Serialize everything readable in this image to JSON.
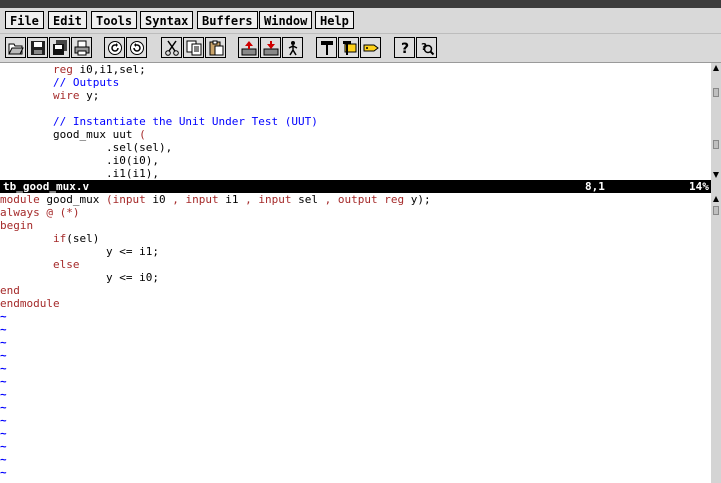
{
  "menu": {
    "file": "File",
    "edit": "Edit",
    "tools": "Tools",
    "syntax": "Syntax",
    "buffers": "Buffers",
    "window": "Window",
    "help": "Help"
  },
  "toolbar": {
    "icons": [
      "open-icon",
      "save-icon",
      "save-all-icon",
      "print-icon",
      "undo-icon",
      "redo-icon",
      "cut-icon",
      "copy-icon",
      "paste-icon",
      "load-session-icon",
      "save-session-icon",
      "run-script-icon",
      "make-icon",
      "build-tags-icon",
      "jump-to-tag-icon",
      "help-icon",
      "find-help-icon"
    ]
  },
  "top_pane": {
    "lines": [
      [
        {
          "t": "        "
        },
        {
          "t": "reg",
          "c": "kw"
        },
        {
          "t": " i0,i1,sel;"
        }
      ],
      [
        {
          "t": "        "
        },
        {
          "t": "// Outputs",
          "c": "comment"
        }
      ],
      [
        {
          "t": "        "
        },
        {
          "t": "wire",
          "c": "kw"
        },
        {
          "t": " y;"
        }
      ],
      [
        {
          "t": ""
        }
      ],
      [
        {
          "t": "        "
        },
        {
          "t": "// Instantiate the Unit Under Test (UUT)",
          "c": "comment"
        }
      ],
      [
        {
          "t": "        good_mux uut "
        },
        {
          "t": "(",
          "c": "kw"
        }
      ],
      [
        {
          "t": "                .sel(sel),"
        }
      ],
      [
        {
          "t": "                .i0(i0),"
        }
      ],
      [
        {
          "t": "                .i1(i1),"
        }
      ]
    ]
  },
  "status": {
    "filename": "tb_good_mux.v",
    "position": "8,1",
    "percent": "14%"
  },
  "bottom_pane": {
    "lines": [
      [
        {
          "t": "module",
          "c": "kw"
        },
        {
          "t": " good_mux "
        },
        {
          "t": "(",
          "c": "kw"
        },
        {
          "t": "input",
          "c": "kw"
        },
        {
          "t": " i0 "
        },
        {
          "t": ",",
          "c": "kw"
        },
        {
          "t": " "
        },
        {
          "t": "input",
          "c": "kw"
        },
        {
          "t": " i1 "
        },
        {
          "t": ",",
          "c": "kw"
        },
        {
          "t": " "
        },
        {
          "t": "input",
          "c": "kw"
        },
        {
          "t": " sel "
        },
        {
          "t": ",",
          "c": "kw"
        },
        {
          "t": " "
        },
        {
          "t": "output",
          "c": "kw"
        },
        {
          "t": " "
        },
        {
          "t": "reg",
          "c": "kw"
        },
        {
          "t": " y);"
        }
      ],
      [
        {
          "t": "always",
          "c": "kw"
        },
        {
          "t": " "
        },
        {
          "t": "@ (*)",
          "c": "kw"
        }
      ],
      [
        {
          "t": "begin",
          "c": "kw"
        }
      ],
      [
        {
          "t": "        "
        },
        {
          "t": "if",
          "c": "kw"
        },
        {
          "t": "(sel)"
        }
      ],
      [
        {
          "t": "                y <= i1;"
        }
      ],
      [
        {
          "t": "        "
        },
        {
          "t": "else",
          "c": "kw"
        }
      ],
      [
        {
          "t": "                y <= i0;"
        }
      ],
      [
        {
          "t": "end",
          "c": "kw"
        }
      ],
      [
        {
          "t": "endmodule",
          "c": "kw"
        }
      ],
      [
        {
          "t": "~",
          "c": "tilde"
        }
      ],
      [
        {
          "t": "~",
          "c": "tilde"
        }
      ],
      [
        {
          "t": "~",
          "c": "tilde"
        }
      ],
      [
        {
          "t": "~",
          "c": "tilde"
        }
      ],
      [
        {
          "t": "~",
          "c": "tilde"
        }
      ],
      [
        {
          "t": "~",
          "c": "tilde"
        }
      ],
      [
        {
          "t": "~",
          "c": "tilde"
        }
      ],
      [
        {
          "t": "~",
          "c": "tilde"
        }
      ],
      [
        {
          "t": "~",
          "c": "tilde"
        }
      ],
      [
        {
          "t": "~",
          "c": "tilde"
        }
      ],
      [
        {
          "t": "~",
          "c": "tilde"
        }
      ],
      [
        {
          "t": "~",
          "c": "tilde"
        }
      ],
      [
        {
          "t": "~",
          "c": "tilde"
        }
      ]
    ]
  },
  "colors": {
    "kw": "#a52a2a",
    "comment": "#0000ff",
    "tilde": "#0000ff",
    "status_bg": "#000000",
    "status_fg": "#ffffff",
    "toolbar_bg": "#d9d9d9"
  }
}
